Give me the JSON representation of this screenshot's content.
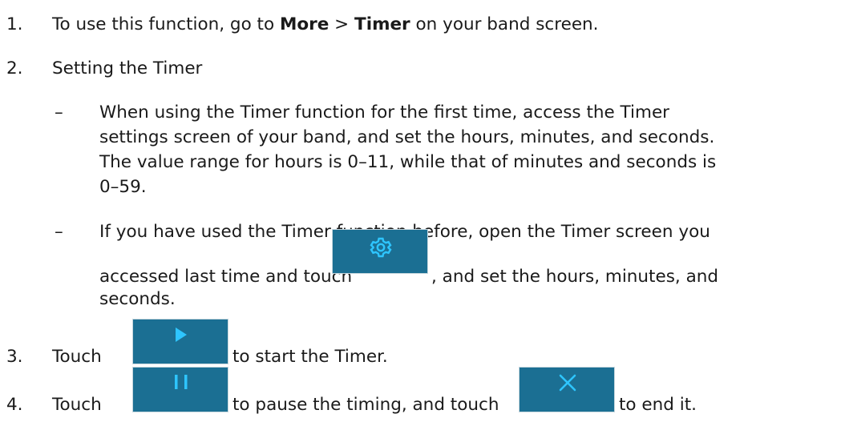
{
  "steps": [
    {
      "number": "1.",
      "text_before": "To use this function, go to ",
      "bold1": "More",
      "sep": " > ",
      "bold2": "Timer",
      "text_after": " on your band screen."
    },
    {
      "number": "2.",
      "text": "Setting the Timer",
      "bullets": [
        {
          "dash": "–",
          "lines": [
            "When using the Timer function for the first time, access the Timer",
            "settings screen of your band, and set the hours, minutes, and seconds.",
            "The value range for hours is 0–11, while that of minutes and seconds is",
            "0–59."
          ]
        },
        {
          "dash": "–",
          "line1": "If you have used the Timer function before, open the Timer screen you",
          "line2_before": "accessed last time and touch ",
          "line2_after": ", and set the hours, minutes, and",
          "line3": "seconds."
        }
      ]
    },
    {
      "number": "3.",
      "before": "Touch ",
      "after": " to start the Timer."
    },
    {
      "number": "4.",
      "before": "Touch ",
      "middle": " to pause the timing, and touch ",
      "after": " to end it."
    }
  ],
  "icons": {
    "settings": "gear-icon",
    "start": "play-icon",
    "pause": "pause-icon",
    "end": "close-icon"
  },
  "colors": {
    "button_bg": "#1b6f93",
    "icon_fg": "#2ec5ff",
    "text": "#1a1a1a"
  }
}
